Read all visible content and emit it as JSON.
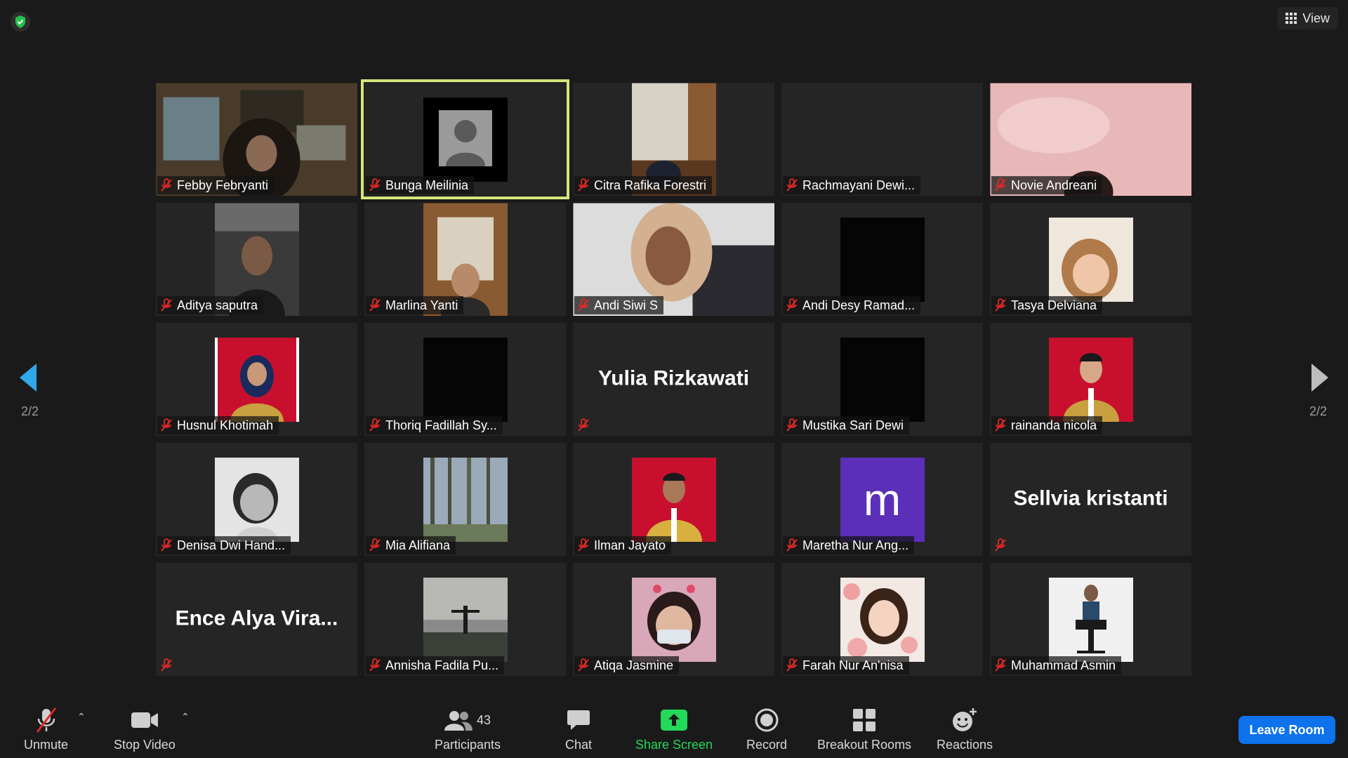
{
  "top": {
    "view_label": "View"
  },
  "pager": {
    "left": "2/2",
    "right": "2/2"
  },
  "tiles": [
    {
      "name": "Febby Febryanti"
    },
    {
      "name": "Bunga Meilinia"
    },
    {
      "name": "Citra Rafika Forestri"
    },
    {
      "name": "Rachmayani Dewi..."
    },
    {
      "name": "Novie Andreani"
    },
    {
      "name": "Aditya saputra"
    },
    {
      "name": "Marlina Yanti"
    },
    {
      "name": "Andi Siwi S"
    },
    {
      "name": "Andi Desy Ramad..."
    },
    {
      "name": "Tasya Delviana"
    },
    {
      "name": "Husnul Khotimah"
    },
    {
      "name": "Thoriq Fadillah Sy..."
    },
    {
      "name": "Yulia Rizkawati"
    },
    {
      "name": "Mustika Sari Dewi"
    },
    {
      "name": "rainanda nicola"
    },
    {
      "name": "Denisa Dwi Hand..."
    },
    {
      "name": "Mia Alifiana"
    },
    {
      "name": "Ilman Jayato"
    },
    {
      "name": "Maretha Nur Ang...",
      "avatar_letter": "m"
    },
    {
      "name": "Sellvia kristanti"
    },
    {
      "name": "Ence Alya Vira..."
    },
    {
      "name": "Annisha Fadila Pu..."
    },
    {
      "name": "Atiqa Jasmine"
    },
    {
      "name": "Farah Nur An'nisa"
    },
    {
      "name": "Muhammad Asmin"
    }
  ],
  "toolbar": {
    "unmute": "Unmute",
    "stop_video": "Stop Video",
    "participants": "Participants",
    "participants_count": "43",
    "chat": "Chat",
    "share_screen": "Share Screen",
    "record": "Record",
    "breakout_rooms": "Breakout Rooms",
    "reactions": "Reactions",
    "leave_room": "Leave Room"
  },
  "colors": {
    "active_speaker_border": "#d5e67a",
    "share_green": "#23d959",
    "leave_blue": "#0e72ed",
    "muted_red": "#e02828"
  }
}
